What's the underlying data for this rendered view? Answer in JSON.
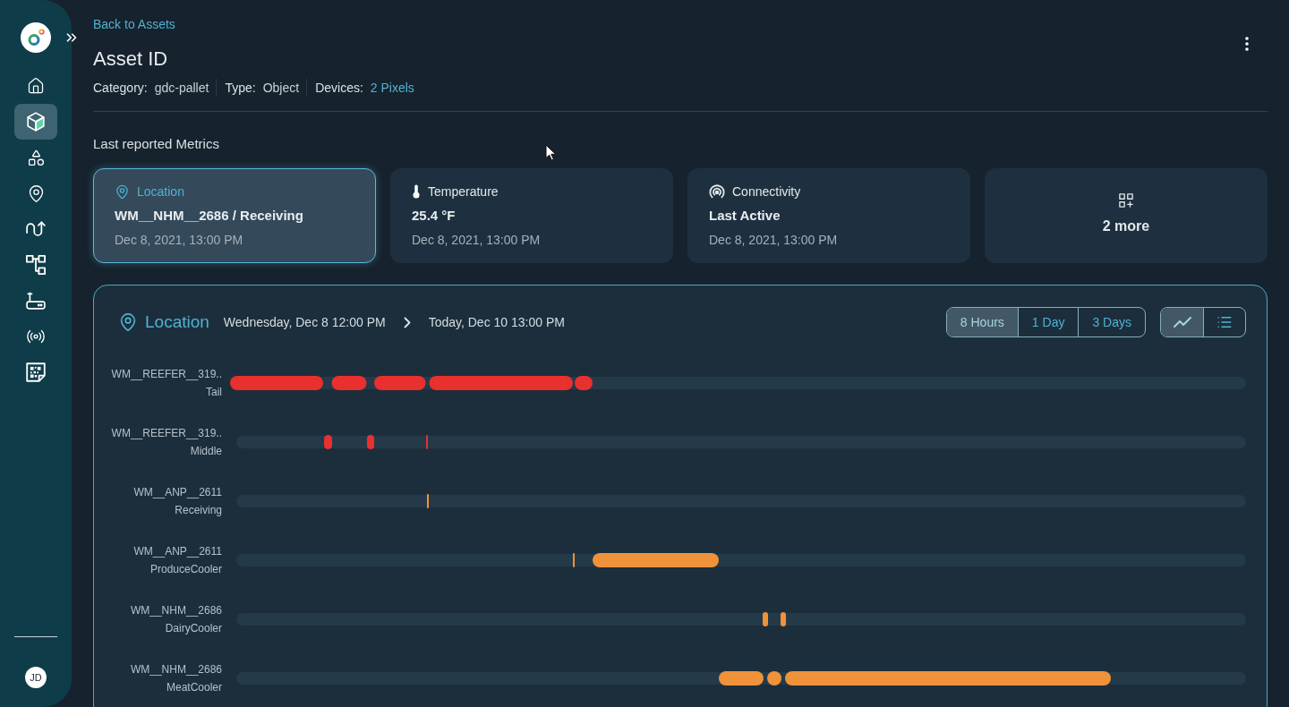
{
  "sidebar": {
    "items": [
      {
        "selected": false
      },
      {
        "selected": true
      },
      {
        "selected": false
      },
      {
        "selected": false
      },
      {
        "selected": false
      },
      {
        "selected": false
      },
      {
        "selected": false
      },
      {
        "selected": false
      },
      {
        "selected": false
      }
    ],
    "avatar": "JD"
  },
  "header": {
    "back_link": "Back to Assets",
    "title": "Asset ID",
    "meta": [
      {
        "kind": "text",
        "label": "Category:",
        "value": "gdc-pallet"
      },
      {
        "kind": "text",
        "label": "Type:",
        "value": "Object"
      },
      {
        "kind": "link",
        "label": "Devices:",
        "value": "2 Pixels"
      }
    ]
  },
  "metrics": {
    "title": "Last reported Metrics",
    "cards": [
      {
        "kind": "metric",
        "label": "Location",
        "value": "WM__NHM__2686 / Receiving",
        "time": "Dec 8, 2021, 13:00 PM",
        "selected": true
      },
      {
        "kind": "metric",
        "label": "Temperature",
        "value": "25.4 °F",
        "time": "Dec 8, 2021, 13:00 PM",
        "selected": false
      },
      {
        "kind": "metric",
        "label": "Connectivity",
        "value": "Last Active",
        "time": "Dec 8, 2021, 13:00 PM",
        "selected": false
      },
      {
        "kind": "more",
        "label": "2 more",
        "selected": false
      }
    ]
  },
  "timeline": {
    "title": "Location",
    "start": "Wednesday, Dec 8 12:00 PM",
    "end": "Today, Dec 10 13:00 PM",
    "ranges": [
      {
        "label": "8 Hours",
        "selected": true
      },
      {
        "label": "1 Day",
        "selected": false
      },
      {
        "label": "3 Days",
        "selected": false
      }
    ],
    "views": [
      {
        "selected": true
      },
      {
        "selected": false
      }
    ],
    "rows": [
      {
        "name": "WM__REEFER__319..",
        "zone": "Tail",
        "color": "#e8302f"
      },
      {
        "name": "WM__REEFER__319..",
        "zone": "Middle",
        "color": "#e8302f"
      },
      {
        "name": "WM__ANP__2611",
        "zone": "Receiving",
        "color": "#f0923a"
      },
      {
        "name": "WM__ANP__2611",
        "zone": "ProduceCooler",
        "color": "#f0923a"
      },
      {
        "name": "WM__NHM__2686",
        "zone": "DairyCooler",
        "color": "#f0923a"
      },
      {
        "name": "WM__NHM__2686",
        "zone": "MeatCooler",
        "color": "#f0923a"
      }
    ]
  }
}
